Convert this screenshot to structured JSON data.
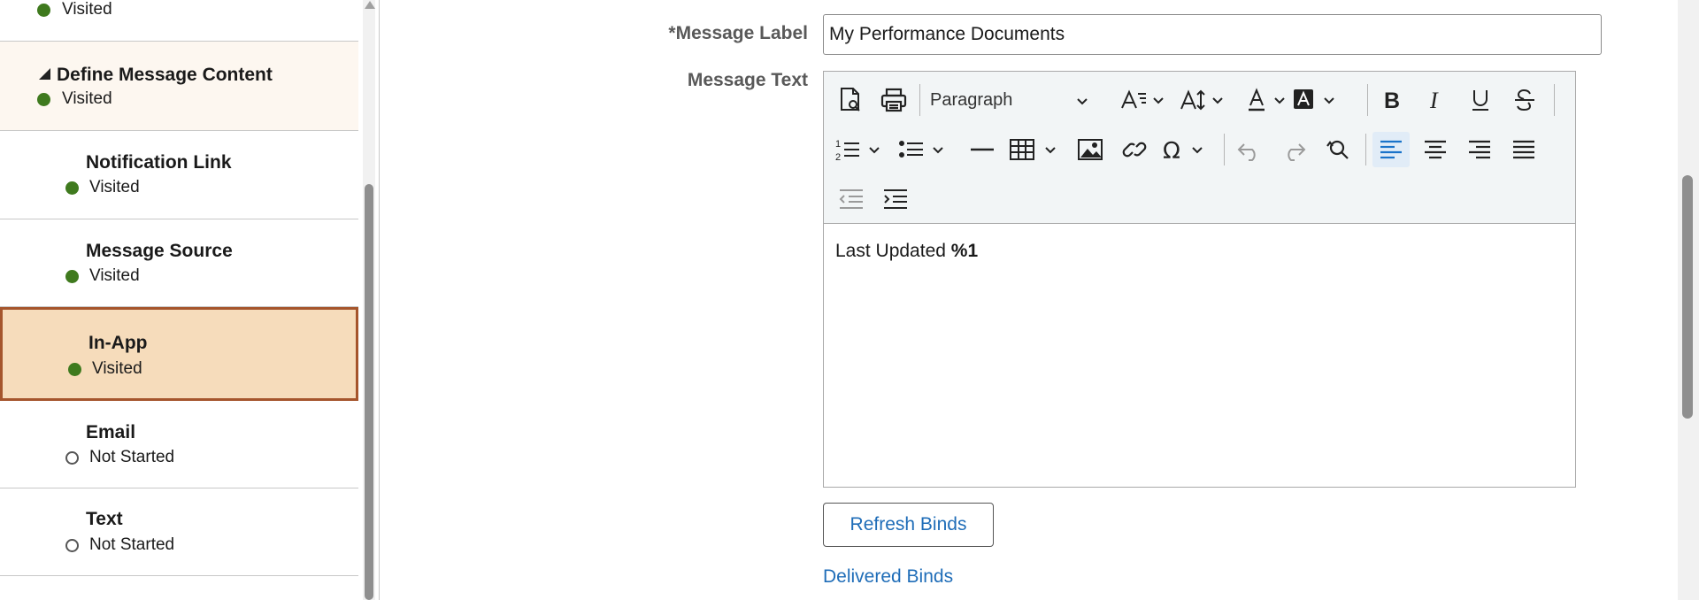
{
  "steps": [
    {
      "title": "",
      "status": "Visited",
      "state": "done"
    },
    {
      "title": "Define Message Content",
      "status": "Visited",
      "state": "done",
      "expanded": true
    },
    {
      "title": "Notification Link",
      "status": "Visited",
      "state": "done"
    },
    {
      "title": "Message Source",
      "status": "Visited",
      "state": "done"
    },
    {
      "title": "In-App",
      "status": "Visited",
      "state": "done",
      "current": true
    },
    {
      "title": "Email",
      "status": "Not Started",
      "state": "todo"
    },
    {
      "title": "Text",
      "status": "Not Started",
      "state": "todo"
    }
  ],
  "form": {
    "message_label": {
      "label": "*Message Label",
      "value": "My Performance Documents"
    },
    "message_text": {
      "label": "Message Text"
    }
  },
  "toolbar": {
    "paragraph": "Paragraph",
    "icons": [
      "preview-icon",
      "print-icon",
      "font-family-icon",
      "font-size-icon",
      "text-color-icon",
      "background-color-icon",
      "bold-icon",
      "italic-icon",
      "underline-icon",
      "strikethrough-icon",
      "numbered-list-icon",
      "bullet-list-icon",
      "horizontal-rule-icon",
      "table-icon",
      "image-icon",
      "link-icon",
      "special-character-icon",
      "undo-icon",
      "redo-icon",
      "find-replace-icon",
      "align-left-icon",
      "align-center-icon",
      "align-right-icon",
      "justify-icon",
      "outdent-icon",
      "indent-icon"
    ]
  },
  "editor": {
    "text": "Last Updated ",
    "bold_token": "%1"
  },
  "buttons": {
    "refresh_binds": "Refresh Binds",
    "delivered_binds": "Delivered Binds"
  },
  "colors": {
    "visited": "#3f7a1e",
    "current_bg": "#f6dcbb",
    "current_border": "#a5552c",
    "link": "#1f6db8",
    "active_align": "#1a73c9"
  }
}
